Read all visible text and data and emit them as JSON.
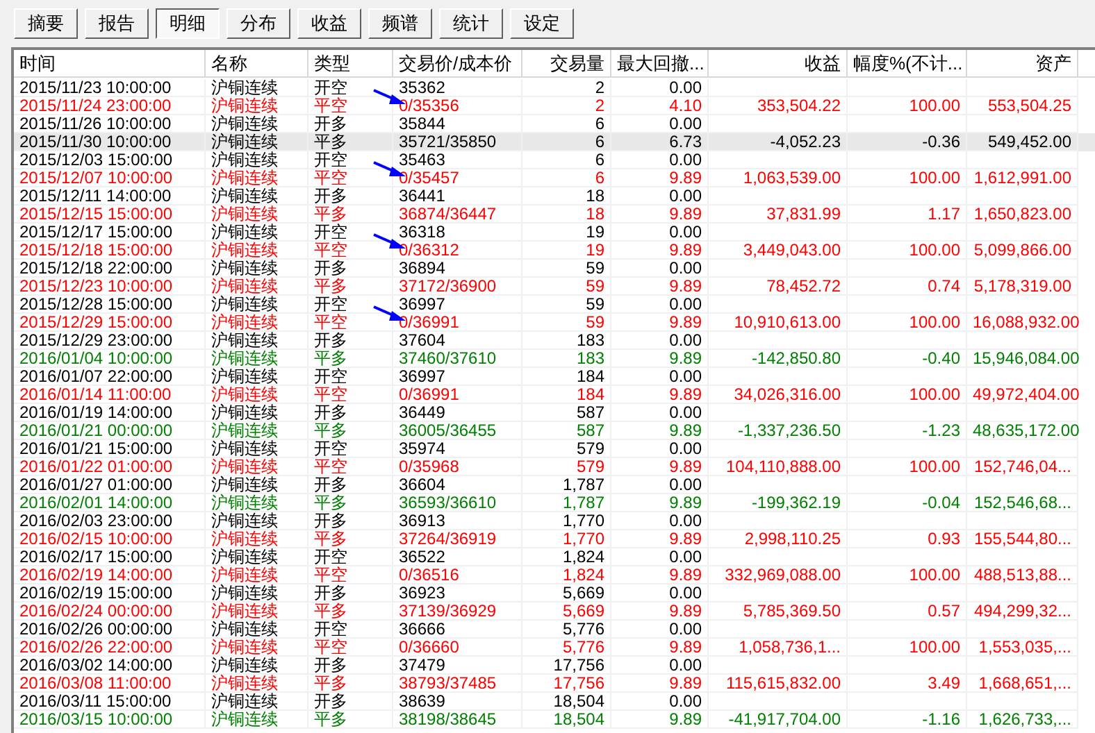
{
  "tabs": [
    {
      "label": "摘要",
      "selected": false
    },
    {
      "label": "报告",
      "selected": false
    },
    {
      "label": "明细",
      "selected": true
    },
    {
      "label": "分布",
      "selected": false
    },
    {
      "label": "收益",
      "selected": false
    },
    {
      "label": "频谱",
      "selected": false
    },
    {
      "label": "统计",
      "selected": false
    },
    {
      "label": "设定",
      "selected": false
    }
  ],
  "table": {
    "columns": [
      "时间",
      "名称",
      "类型",
      "交易价/成本价",
      "交易量",
      "最大回撤...",
      "收益",
      "幅度%(不计...",
      "资产"
    ],
    "rows": [
      {
        "cells": [
          "2015/11/23 10:00:00",
          "沪铜连续",
          "开空",
          "35362",
          "2",
          "0.00"
        ],
        "color": "#000000",
        "selected": false,
        "arrow": false
      },
      {
        "cells": [
          "2015/11/24 23:00:00",
          "沪铜连续",
          "平空",
          "0/35356",
          "2",
          "4.10",
          "353,504.22",
          "100.00",
          "553,504.25"
        ],
        "color": "#ff0000",
        "selected": false,
        "arrow": true
      },
      {
        "cells": [
          "2015/11/26 10:00:00",
          "沪铜连续",
          "开多",
          "35844",
          "6",
          "0.00"
        ],
        "color": "#000000",
        "selected": false,
        "arrow": false
      },
      {
        "cells": [
          "2015/11/30 10:00:00",
          "沪铜连续",
          "平多",
          "35721/35850",
          "6",
          "6.73",
          "-4,052.23",
          "-0.36",
          "549,452.00"
        ],
        "color": "#000000",
        "selected": true,
        "arrow": false
      },
      {
        "cells": [
          "2015/12/03 15:00:00",
          "沪铜连续",
          "开空",
          "35463",
          "6",
          "0.00"
        ],
        "color": "#000000",
        "selected": false,
        "arrow": false
      },
      {
        "cells": [
          "2015/12/07 10:00:00",
          "沪铜连续",
          "平空",
          "0/35457",
          "6",
          "9.89",
          "1,063,539.00",
          "100.00",
          "1,612,991.00"
        ],
        "color": "#ff0000",
        "selected": false,
        "arrow": true
      },
      {
        "cells": [
          "2015/12/11 14:00:00",
          "沪铜连续",
          "开多",
          "36441",
          "18",
          "0.00"
        ],
        "color": "#000000",
        "selected": false,
        "arrow": false
      },
      {
        "cells": [
          "2015/12/15 15:00:00",
          "沪铜连续",
          "平多",
          "36874/36447",
          "18",
          "9.89",
          "37,831.99",
          "1.17",
          "1,650,823.00"
        ],
        "color": "#ff0000",
        "selected": false,
        "arrow": false
      },
      {
        "cells": [
          "2015/12/17 15:00:00",
          "沪铜连续",
          "开空",
          "36318",
          "19",
          "0.00"
        ],
        "color": "#000000",
        "selected": false,
        "arrow": false
      },
      {
        "cells": [
          "2015/12/18 15:00:00",
          "沪铜连续",
          "平空",
          "0/36312",
          "19",
          "9.89",
          "3,449,043.00",
          "100.00",
          "5,099,866.00"
        ],
        "color": "#ff0000",
        "selected": false,
        "arrow": true
      },
      {
        "cells": [
          "2015/12/18 22:00:00",
          "沪铜连续",
          "开多",
          "36894",
          "59",
          "0.00"
        ],
        "color": "#000000",
        "selected": false,
        "arrow": false
      },
      {
        "cells": [
          "2015/12/23 10:00:00",
          "沪铜连续",
          "平多",
          "37172/36900",
          "59",
          "9.89",
          "78,452.72",
          "0.74",
          "5,178,319.00"
        ],
        "color": "#ff0000",
        "selected": false,
        "arrow": false
      },
      {
        "cells": [
          "2015/12/28 15:00:00",
          "沪铜连续",
          "开空",
          "36997",
          "59",
          "0.00"
        ],
        "color": "#000000",
        "selected": false,
        "arrow": false
      },
      {
        "cells": [
          "2015/12/29 15:00:00",
          "沪铜连续",
          "平空",
          "0/36991",
          "59",
          "9.89",
          "10,910,613.00",
          "100.00",
          "16,088,932.00"
        ],
        "color": "#ff0000",
        "selected": false,
        "arrow": true
      },
      {
        "cells": [
          "2015/12/29 23:00:00",
          "沪铜连续",
          "开多",
          "37604",
          "183",
          "0.00"
        ],
        "color": "#000000",
        "selected": false,
        "arrow": false
      },
      {
        "cells": [
          "2016/01/04 10:00:00",
          "沪铜连续",
          "平多",
          "37460/37610",
          "183",
          "9.89",
          "-142,850.80",
          "-0.40",
          "15,946,084.00"
        ],
        "color": "#008000",
        "selected": false,
        "arrow": false
      },
      {
        "cells": [
          "2016/01/07 22:00:00",
          "沪铜连续",
          "开空",
          "36997",
          "184",
          "0.00"
        ],
        "color": "#000000",
        "selected": false,
        "arrow": false
      },
      {
        "cells": [
          "2016/01/14 11:00:00",
          "沪铜连续",
          "平空",
          "0/36991",
          "184",
          "9.89",
          "34,026,316.00",
          "100.00",
          "49,972,404.00"
        ],
        "color": "#ff0000",
        "selected": false,
        "arrow": false
      },
      {
        "cells": [
          "2016/01/19 14:00:00",
          "沪铜连续",
          "开多",
          "36449",
          "587",
          "0.00"
        ],
        "color": "#000000",
        "selected": false,
        "arrow": false
      },
      {
        "cells": [
          "2016/01/21 00:00:00",
          "沪铜连续",
          "平多",
          "36005/36455",
          "587",
          "9.89",
          "-1,337,236.50",
          "-1.23",
          "48,635,172.00"
        ],
        "color": "#008000",
        "selected": false,
        "arrow": false
      },
      {
        "cells": [
          "2016/01/21 15:00:00",
          "沪铜连续",
          "开空",
          "35974",
          "579",
          "0.00"
        ],
        "color": "#000000",
        "selected": false,
        "arrow": false
      },
      {
        "cells": [
          "2016/01/22 01:00:00",
          "沪铜连续",
          "平空",
          "0/35968",
          "579",
          "9.89",
          "104,110,888.00",
          "100.00",
          "152,746,04..."
        ],
        "color": "#ff0000",
        "selected": false,
        "arrow": false
      },
      {
        "cells": [
          "2016/01/27 01:00:00",
          "沪铜连续",
          "开多",
          "36604",
          "1,787",
          "0.00"
        ],
        "color": "#000000",
        "selected": false,
        "arrow": false
      },
      {
        "cells": [
          "2016/02/01 14:00:00",
          "沪铜连续",
          "平多",
          "36593/36610",
          "1,787",
          "9.89",
          "-199,362.19",
          "-0.04",
          "152,546,68..."
        ],
        "color": "#008000",
        "selected": false,
        "arrow": false
      },
      {
        "cells": [
          "2016/02/03 23:00:00",
          "沪铜连续",
          "开多",
          "36913",
          "1,770",
          "0.00"
        ],
        "color": "#000000",
        "selected": false,
        "arrow": false
      },
      {
        "cells": [
          "2016/02/15 10:00:00",
          "沪铜连续",
          "平多",
          "37264/36919",
          "1,770",
          "9.89",
          "2,998,110.25",
          "0.93",
          "155,544,80..."
        ],
        "color": "#ff0000",
        "selected": false,
        "arrow": false
      },
      {
        "cells": [
          "2016/02/17 15:00:00",
          "沪铜连续",
          "开空",
          "36522",
          "1,824",
          "0.00"
        ],
        "color": "#000000",
        "selected": false,
        "arrow": false
      },
      {
        "cells": [
          "2016/02/19 14:00:00",
          "沪铜连续",
          "平空",
          "0/36516",
          "1,824",
          "9.89",
          "332,969,088.00",
          "100.00",
          "488,513,88..."
        ],
        "color": "#ff0000",
        "selected": false,
        "arrow": false
      },
      {
        "cells": [
          "2016/02/19 15:00:00",
          "沪铜连续",
          "开多",
          "36923",
          "5,669",
          "0.00"
        ],
        "color": "#000000",
        "selected": false,
        "arrow": false
      },
      {
        "cells": [
          "2016/02/24 00:00:00",
          "沪铜连续",
          "平多",
          "37139/36929",
          "5,669",
          "9.89",
          "5,785,369.50",
          "0.57",
          "494,299,32..."
        ],
        "color": "#ff0000",
        "selected": false,
        "arrow": false
      },
      {
        "cells": [
          "2016/02/26 00:00:00",
          "沪铜连续",
          "开空",
          "36666",
          "5,776",
          "0.00"
        ],
        "color": "#000000",
        "selected": false,
        "arrow": false
      },
      {
        "cells": [
          "2016/02/26 22:00:00",
          "沪铜连续",
          "平空",
          "0/36660",
          "5,776",
          "9.89",
          "1,058,736,1...",
          "100.00",
          "1,553,035,..."
        ],
        "color": "#ff0000",
        "selected": false,
        "arrow": false
      },
      {
        "cells": [
          "2016/03/02 14:00:00",
          "沪铜连续",
          "开多",
          "37479",
          "17,756",
          "0.00"
        ],
        "color": "#000000",
        "selected": false,
        "arrow": false
      },
      {
        "cells": [
          "2016/03/08 11:00:00",
          "沪铜连续",
          "平多",
          "38793/37485",
          "17,756",
          "9.89",
          "115,615,832.00",
          "3.49",
          "1,668,651,..."
        ],
        "color": "#ff0000",
        "selected": false,
        "arrow": false
      },
      {
        "cells": [
          "2016/03/11 15:00:00",
          "沪铜连续",
          "开多",
          "38639",
          "18,504",
          "0.00"
        ],
        "color": "#000000",
        "selected": false,
        "arrow": false
      },
      {
        "cells": [
          "2016/03/15 10:00:00",
          "沪铜连续",
          "平多",
          "38198/38645",
          "18,504",
          "9.89",
          "-41,917,704.00",
          "-1.16",
          "1,626,733,..."
        ],
        "color": "#008000",
        "selected": false,
        "arrow": false
      }
    ]
  }
}
